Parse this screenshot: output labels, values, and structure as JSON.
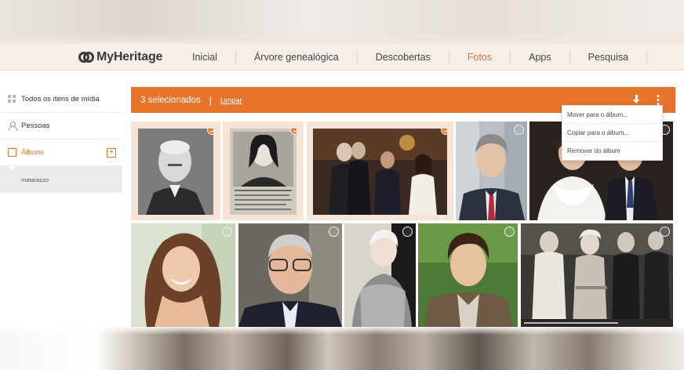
{
  "brand": {
    "name": "MyHeritage"
  },
  "nav": {
    "items": [
      {
        "label": "Inicial"
      },
      {
        "label": "Árvore genealógica"
      },
      {
        "label": "Descobertas"
      },
      {
        "label": "Fotos"
      },
      {
        "label": "Apps"
      },
      {
        "label": "Pesquisa"
      }
    ],
    "active": "Fotos"
  },
  "sidebar": {
    "items": [
      {
        "label": "Todos os itens de mídia",
        "icon": "grid-icon"
      },
      {
        "label": "Pessoas",
        "icon": "person-icon"
      },
      {
        "label": "Álbuns",
        "icon": "album-icon"
      }
    ],
    "add_album_symbol": "+",
    "albums": [
      {
        "label": "matarazzo"
      }
    ]
  },
  "selection": {
    "count_label": "3 selecionados",
    "separator": "|",
    "clear_label": "Limpar"
  },
  "menu": {
    "items": [
      {
        "label": "Mover para o álbum..."
      },
      {
        "label": "Copiar para o álbum..."
      },
      {
        "label": "Remover do álbum"
      }
    ]
  },
  "photos": [
    {
      "subject": "man-portrait-bw",
      "selected": true
    },
    {
      "subject": "woman-news-clipping",
      "selected": true,
      "caption": "Maria Pia, 18 anos, é a cacula mimada pelo pai, procurou ganhar a tradição..."
    },
    {
      "subject": "group-gathering",
      "selected": true
    },
    {
      "subject": "man-in-suit",
      "selected": false
    },
    {
      "subject": "couple-formal",
      "selected": false
    },
    {
      "subject": "woman-smiling",
      "selected": false
    },
    {
      "subject": "older-man-glasses",
      "selected": false
    },
    {
      "subject": "elderly-woman",
      "selected": false
    },
    {
      "subject": "young-man",
      "selected": false
    },
    {
      "subject": "vintage-group-photo",
      "selected": false
    }
  ],
  "colors": {
    "accent": "#e8732a",
    "header_bg": "#f6efe9",
    "sidebar_active_bg": "#ececec"
  }
}
